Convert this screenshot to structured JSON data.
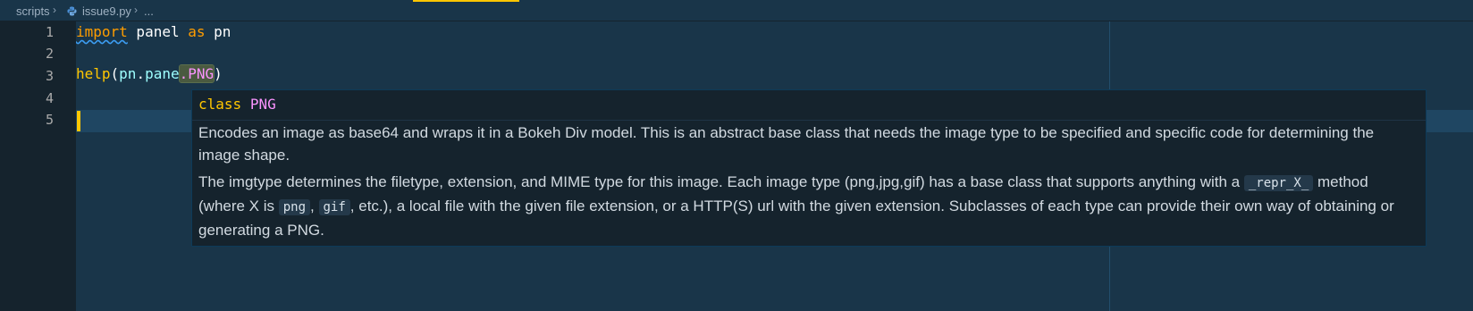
{
  "breadcrumb": {
    "folder": "scripts",
    "file": "issue9.py",
    "symbol": "...",
    "separator": "›"
  },
  "gutter": {
    "line_numbers": [
      "1",
      "2",
      "3",
      "4",
      "5"
    ]
  },
  "code": {
    "line1": {
      "kw_import": "import",
      "module": " panel ",
      "kw_as": "as",
      "alias": " pn"
    },
    "line3": {
      "fn": "help",
      "open": "(",
      "obj": "pn",
      "dot1": ".",
      "attr": "pane",
      "dot2": ".",
      "cls": "PNG",
      "close": ")"
    }
  },
  "hover": {
    "signature": {
      "keyword": "class",
      "name": "PNG"
    },
    "para1": "Encodes an image as base64 and wraps it in a Bokeh Div model. This is an abstract base class that needs the image type to be specified and specific code for determining the image shape.",
    "para2": {
      "part1": "The imgtype determines the filetype, extension, and MIME type for this image. Each image type (png,jpg,gif) has a base class that supports anything with a ",
      "code1": "_repr_X_",
      "part2": " method (where X is ",
      "code2": "png",
      "part3": ", ",
      "code3": "gif",
      "part4": ", etc.), a local file with the given file extension, or a HTTP(S) url with the given extension. Subclasses of each type can provide their own way of obtaining or generating a PNG."
    }
  },
  "colors": {
    "background": "#193549",
    "gutter": "#15232d",
    "keyword": "#ff9d00",
    "function": "#ffc600",
    "attribute": "#9effff",
    "class_name": "#fb94ff",
    "accent": "#ffc600"
  },
  "icons": {
    "file_icon": "python-icon"
  }
}
